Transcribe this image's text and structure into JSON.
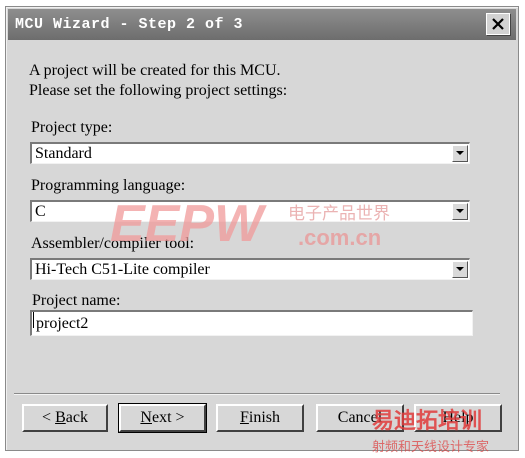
{
  "window": {
    "title": "MCU Wizard - Step 2 of 3"
  },
  "intro": {
    "line1": "A project will be created for this MCU.",
    "line2": "Please set the following project settings:"
  },
  "fields": {
    "project_type": {
      "label": "Project type:",
      "value": "Standard"
    },
    "programming_language": {
      "label": "Programming language:",
      "value": "C"
    },
    "assembler_compiler": {
      "label": "Assembler/compiler tool:",
      "value": "Hi-Tech C51-Lite compiler"
    },
    "project_name": {
      "label": "Project name:",
      "value": "project2"
    }
  },
  "buttons": {
    "back": {
      "prefix": "< ",
      "accel": "B",
      "rest": "ack"
    },
    "next": {
      "accel": "N",
      "rest": "ext >"
    },
    "finish": {
      "accel": "F",
      "rest": "inish"
    },
    "cancel": {
      "label": "Cancel"
    },
    "help": {
      "label": "Help"
    }
  },
  "watermark": {
    "brand": "EEPW",
    "domain": ".com.cn",
    "cn_tag": "电子产品世界",
    "corner_brand": "易迪拓培训",
    "corner_tag": "射频和天线设计专家"
  },
  "colors": {
    "titlebar": "#7a7a7a",
    "window_bg": "#d7d7d7",
    "watermark_red": "#e03b3b",
    "watermark_pink": "#f3b9b9"
  },
  "icons": {
    "close": "close-icon",
    "dropdown": "chevron-down-icon"
  }
}
